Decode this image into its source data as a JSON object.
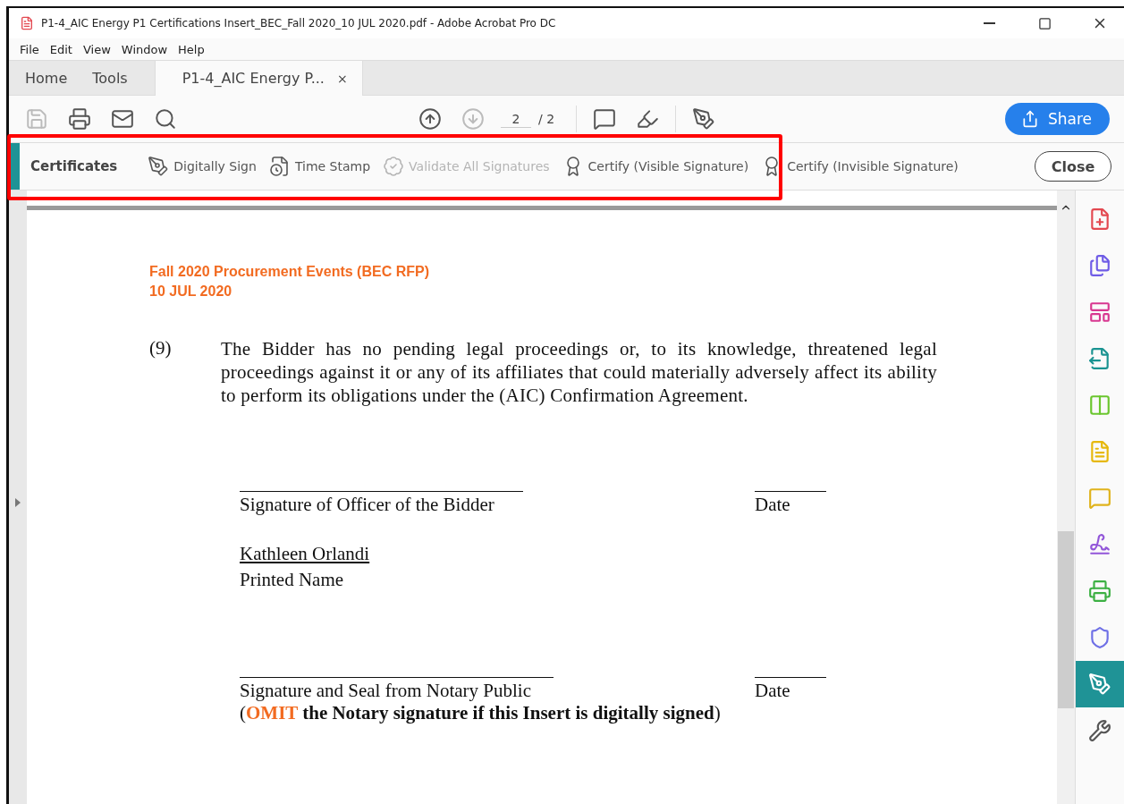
{
  "window": {
    "title": "P1-4_AIC Energy P1 Certifications Insert_BEC_Fall 2020_10 JUL 2020.pdf - Adobe Acrobat Pro DC"
  },
  "menu": [
    "File",
    "Edit",
    "View",
    "Window",
    "Help"
  ],
  "tabs": [
    {
      "label": "Home",
      "selected": false
    },
    {
      "label": "Tools",
      "selected": false
    },
    {
      "label": "P1-4_AIC Energy P...",
      "selected": true,
      "close": "×"
    }
  ],
  "toolbar": {
    "buttons": [
      {
        "kind": "save",
        "disabled": true
      },
      {
        "kind": "print",
        "disabled": false
      },
      {
        "kind": "mail",
        "disabled": false
      },
      {
        "kind": "find",
        "disabled": false
      },
      {
        "kind": "up",
        "disabled": false
      },
      {
        "kind": "down",
        "disabled": true
      },
      {
        "kind": "page"
      },
      {
        "kind": "comment",
        "disabled": false
      },
      {
        "kind": "highlight",
        "disabled": false
      },
      {
        "kind": "sign",
        "disabled": false
      }
    ],
    "page_value": "2",
    "page_total": "/ 2",
    "share": "Share"
  },
  "certificates": {
    "title": "Certificates",
    "tools": [
      {
        "kind": "sign",
        "label": "Digitally Sign",
        "disabled": false
      },
      {
        "kind": "stamp",
        "label": "Time Stamp",
        "disabled": false
      },
      {
        "kind": "validate",
        "label": "Validate All Signatures",
        "disabled": true
      },
      {
        "kind": "certify-visible",
        "label": "Certify (Visible Signature)",
        "disabled": false
      },
      {
        "kind": "certify",
        "label": "Certify (Invisible Signature)",
        "disabled": false
      }
    ],
    "close": "Close"
  },
  "document": {
    "header": [
      "Fall 2020 Procurement Events (BEC RFP)",
      "10 JUL 2020"
    ],
    "item_number": "(9)",
    "paragraph": "The Bidder has no pending legal proceedings or, to its knowledge, threatened legal proceedings against it or any of its affiliates that could materially adversely affect its ability to perform its obligations under the (AIC) Confirmation Agreement.",
    "officer_signature": "Signature of Officer of the Bidder",
    "date_1": "Date",
    "printed_name_value": "Kathleen Orlandi",
    "printed_name_label": "Printed Name",
    "notary_signature": "Signature and Seal from Notary Public",
    "date_2": "Date",
    "note": {
      "open": "(",
      "emphasis": "OMIT",
      "rest": " the Notary signature if this Insert is digitally signed",
      "close": ")"
    }
  },
  "side_tools": [
    {
      "kind": "create",
      "color": "#e34850",
      "selected": false
    },
    {
      "kind": "combine",
      "color": "#6f5ce6",
      "selected": false
    },
    {
      "kind": "organize",
      "color": "#d83790",
      "selected": false
    },
    {
      "kind": "export",
      "color": "#1a9391",
      "selected": false
    },
    {
      "kind": "compare",
      "color": "#6bc62f",
      "selected": false
    },
    {
      "kind": "edit",
      "color": "#e6b80c",
      "selected": false
    },
    {
      "kind": "comment",
      "color": "#e0b31c",
      "selected": false
    },
    {
      "kind": "fill-sign",
      "color": "#9256d9",
      "selected": false
    },
    {
      "kind": "print-production",
      "color": "#3cb043",
      "selected": false
    },
    {
      "kind": "protect",
      "color": "#6f70e6",
      "selected": false
    },
    {
      "kind": "certificates",
      "color": "#ffffff",
      "selected": true
    },
    {
      "kind": "more-tools",
      "color": "#555555",
      "selected": false
    }
  ]
}
